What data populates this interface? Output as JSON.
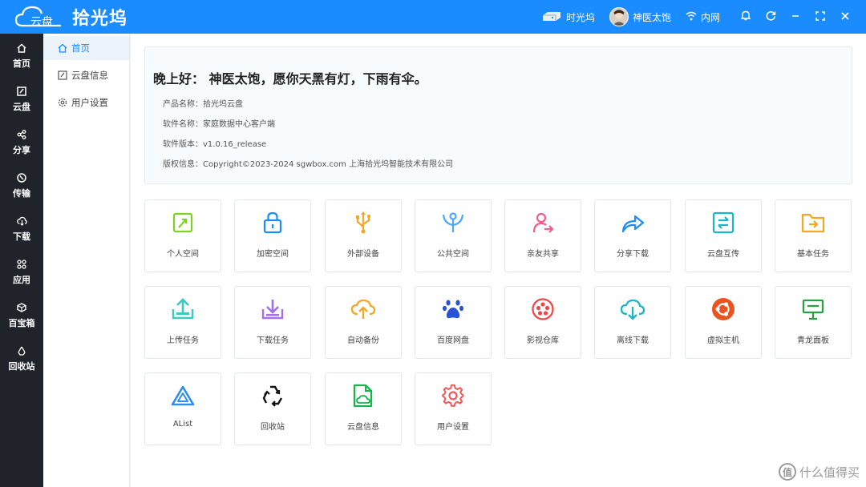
{
  "app": {
    "logo_cloud_text": "云盘",
    "logo_text": "拾光坞"
  },
  "titlebar": {
    "device_label": "时光坞",
    "user_label": "神医太饱",
    "network_label": "内网"
  },
  "leftnav": [
    {
      "label": "首页",
      "icon": "home-icon"
    },
    {
      "label": "云盘",
      "icon": "cloud-disk-icon"
    },
    {
      "label": "分享",
      "icon": "share-icon"
    },
    {
      "label": "传输",
      "icon": "transfer-icon"
    },
    {
      "label": "下载",
      "icon": "download-icon"
    },
    {
      "label": "应用",
      "icon": "apps-icon"
    },
    {
      "label": "百宝箱",
      "icon": "toolbox-icon"
    },
    {
      "label": "回收站",
      "icon": "recycle-icon"
    }
  ],
  "subnav": [
    {
      "label": "首页",
      "icon": "home-icon",
      "active": true
    },
    {
      "label": "云盘信息",
      "icon": "disk-info-icon",
      "active": false
    },
    {
      "label": "用户设置",
      "icon": "gear-icon",
      "active": false
    }
  ],
  "welcome": {
    "greeting": "晚上好： 神医太饱，愿你天黑有灯，下雨有伞。",
    "product_name": "产品名称：拾光坞云盘",
    "software_name": "软件名称：家庭数据中心客户端",
    "software_version": "软件版本：v1.0.16_release",
    "copyright": "版权信息：Copyright©2023-2024 sgwbox.com 上海拾光坞智能技术有限公司"
  },
  "tiles": [
    {
      "label": "个人空间",
      "icon": "personal-space-icon",
      "color": "#7ed321"
    },
    {
      "label": "加密空间",
      "icon": "lock-icon",
      "color": "#1a8cff"
    },
    {
      "label": "外部设备",
      "icon": "usb-icon",
      "color": "#f5a623"
    },
    {
      "label": "公共空间",
      "icon": "public-space-icon",
      "color": "#4aa8ff"
    },
    {
      "label": "亲友共享",
      "icon": "family-share-icon",
      "color": "#f25c8e"
    },
    {
      "label": "分享下载",
      "icon": "share-arrow-icon",
      "color": "#1a8cff"
    },
    {
      "label": "云盘互传",
      "icon": "cloud-transfer-icon",
      "color": "#1cb5c7"
    },
    {
      "label": "基本任务",
      "icon": "folder-task-icon",
      "color": "#f5a623"
    },
    {
      "label": "上传任务",
      "icon": "upload-task-icon",
      "color": "#3cc9c0"
    },
    {
      "label": "下载任务",
      "icon": "download-task-icon",
      "color": "#a66ee8"
    },
    {
      "label": "自动备份",
      "icon": "cloud-backup-icon",
      "color": "#f5a623"
    },
    {
      "label": "百度网盘",
      "icon": "baidu-paw-icon",
      "color": "#2a52d6"
    },
    {
      "label": "影视仓库",
      "icon": "film-reel-icon",
      "color": "#f04848"
    },
    {
      "label": "离线下载",
      "icon": "cloud-download-icon",
      "color": "#1cb5c7"
    },
    {
      "label": "虚拟主机",
      "icon": "ubuntu-icon",
      "color": "#e95420"
    },
    {
      "label": "青龙面板",
      "icon": "panel-icon",
      "color": "#2e9e44"
    },
    {
      "label": "AList",
      "icon": "alist-icon",
      "color": "#2f8ff0"
    },
    {
      "label": "回收站",
      "icon": "recycle-icon",
      "color": "#111111"
    },
    {
      "label": "云盘信息",
      "icon": "disk-info-icon",
      "color": "#19b24b"
    },
    {
      "label": "用户设置",
      "icon": "gear-icon",
      "color": "#f05a5a"
    }
  ],
  "watermark": {
    "symbol": "值",
    "text": "什么值得买"
  },
  "colors": {
    "accent": "#1a8cff",
    "sidebar_dark": "#20232a"
  }
}
